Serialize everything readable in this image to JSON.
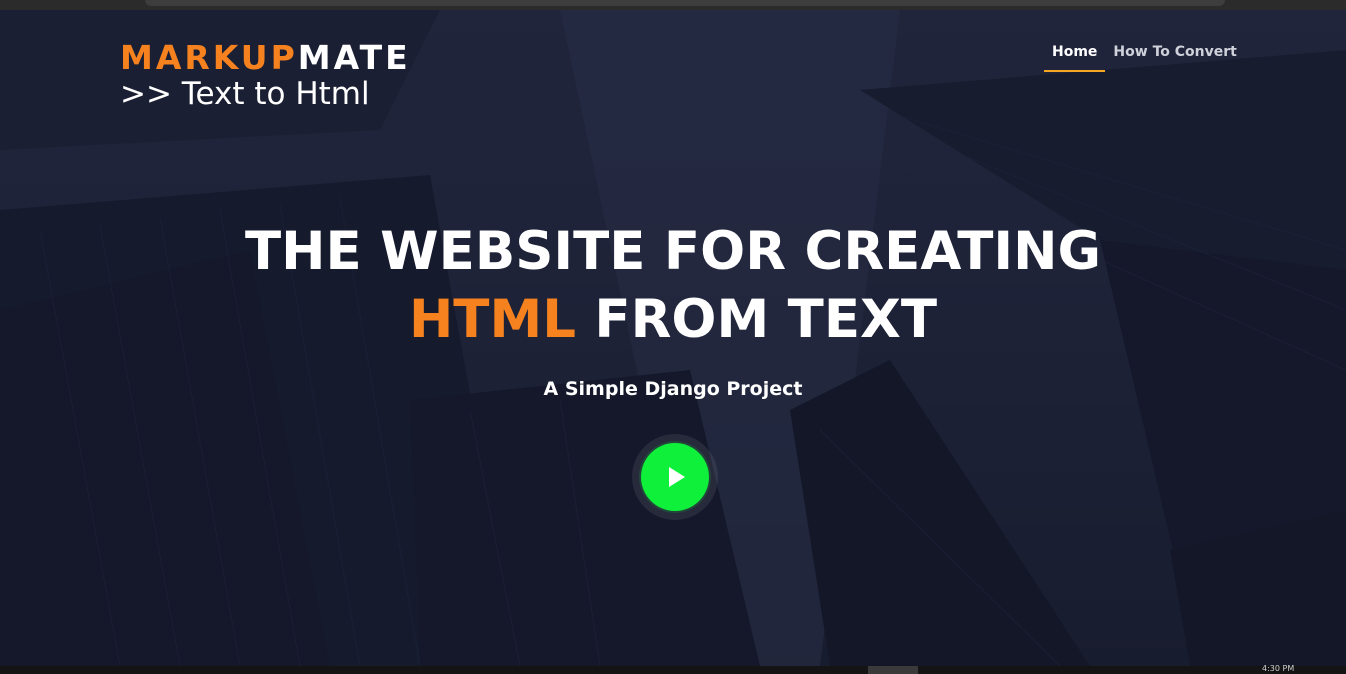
{
  "brand": {
    "accent_word": "MARKUP",
    "rest_word": "MATE",
    "tagline": ">> Text to Html",
    "accent_color": "#f5821f"
  },
  "nav": {
    "items": [
      {
        "label": "Home",
        "active": true
      },
      {
        "label": "How To Convert",
        "active": false
      }
    ],
    "active_underline_color": "#f5a623"
  },
  "hero": {
    "line1": "THE WEBSITE FOR CREATING",
    "line2_accent": "HTML",
    "line2_rest": " FROM TEXT",
    "subtitle": "A Simple Django Project",
    "play_icon": "play-icon",
    "play_color": "#0ef03a"
  },
  "taskbar": {
    "clock": "4:30 PM"
  }
}
